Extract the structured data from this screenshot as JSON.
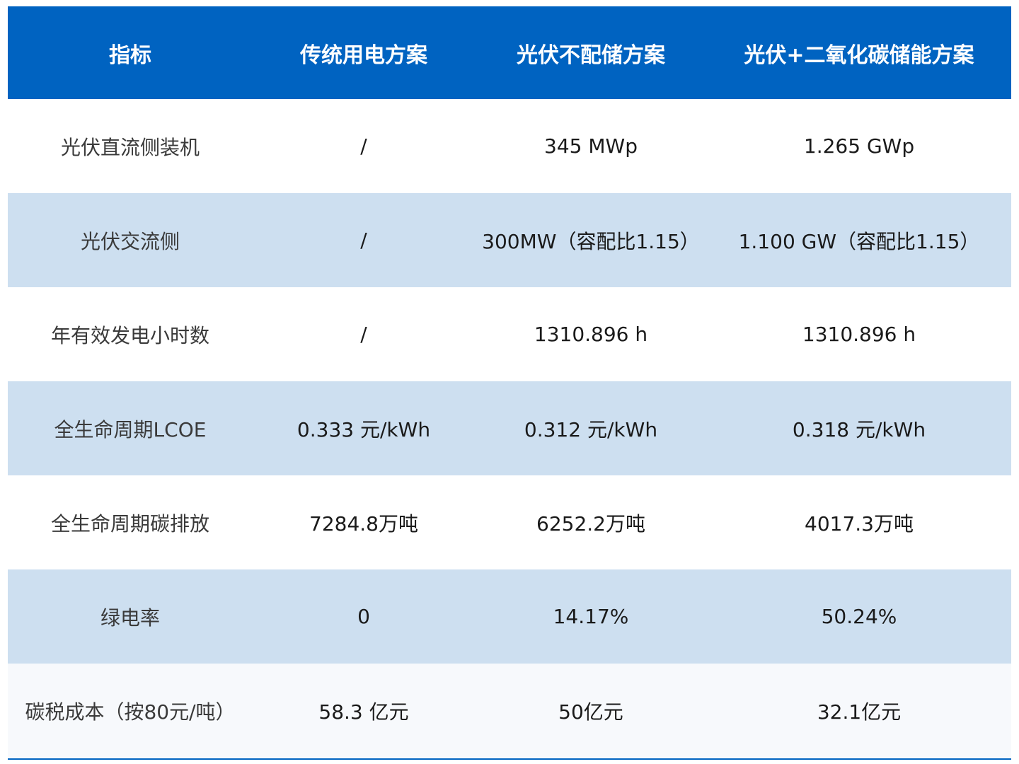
{
  "header": {
    "columns": [
      "指标",
      "传统用电方案",
      "光伏不配储方案",
      "光伏+二氧化碳储能方案"
    ]
  },
  "rows": [
    {
      "label": "光伏直流侧装机",
      "values": [
        "/",
        "345 MWp",
        "1.265 GWp"
      ]
    },
    {
      "label": "光伏交流侧",
      "values": [
        "/",
        "300MW（容配比1.15）",
        "1.100 GW（容配比1.15）"
      ]
    },
    {
      "label": "年有效发电小时数",
      "values": [
        "/",
        "1310.896 h",
        "1310.896 h"
      ]
    },
    {
      "label": "全生命周期LCOE",
      "values": [
        "0.333 元/kWh",
        "0.312 元/kWh",
        "0.318 元/kWh"
      ]
    },
    {
      "label": "全生命周期碳排放",
      "values": [
        "7284.8万吨",
        "6252.2万吨",
        "4017.3万吨"
      ]
    },
    {
      "label": "绿电率",
      "values": [
        "0",
        "14.17%",
        "50.24%"
      ]
    },
    {
      "label": "碳税成本（按80元/吨）",
      "values": [
        "58.3 亿元",
        "50亿元",
        "32.1亿元"
      ]
    }
  ],
  "colors": {
    "header_bg": "#0063c1",
    "header_text": "#ffffff",
    "stripe_bg": "#cddff0",
    "white_bg": "#ffffff",
    "last_row_bg": "#f7f9fc"
  }
}
